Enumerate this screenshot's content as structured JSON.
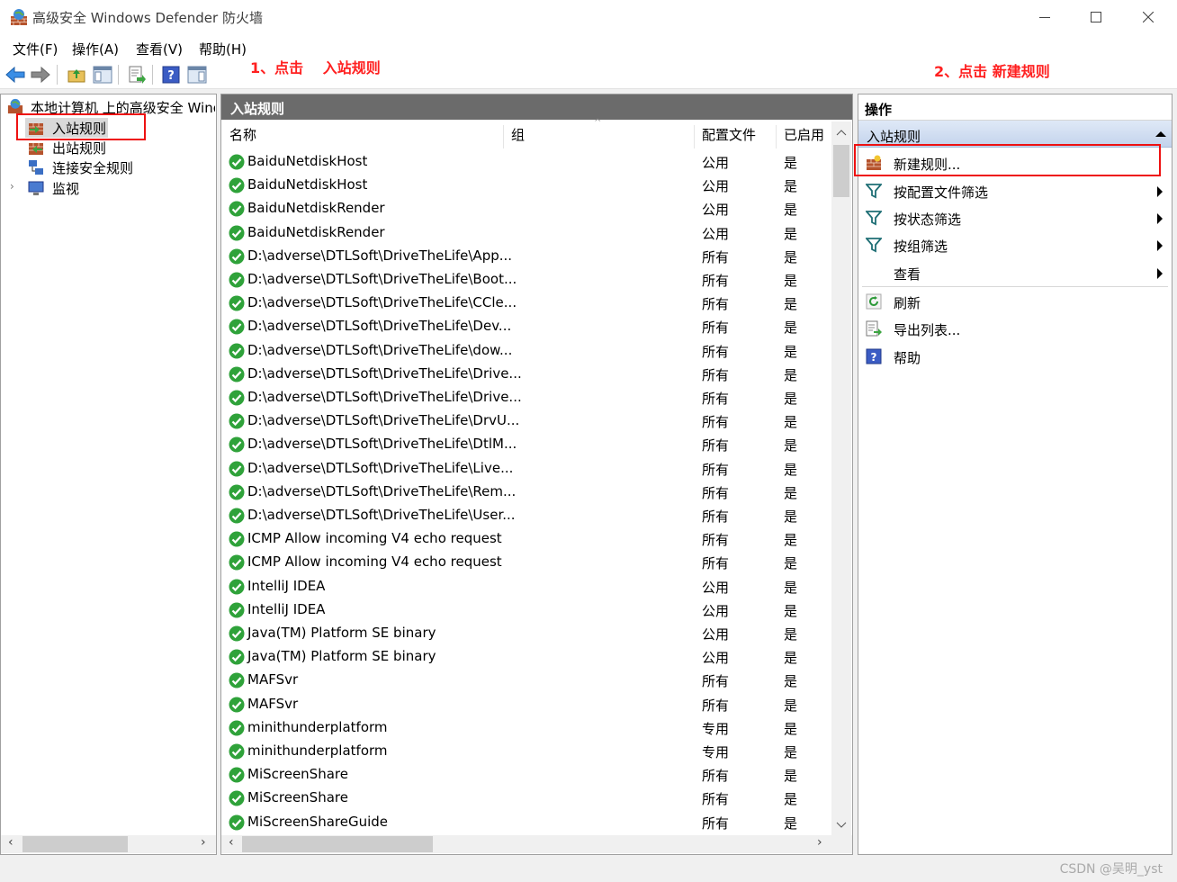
{
  "window": {
    "title": "高级安全 Windows Defender 防火墙",
    "icon": "firewall-globe-icon"
  },
  "menu": [
    "文件(F)",
    "操作(A)",
    "查看(V)",
    "帮助(H)"
  ],
  "annotations": {
    "step1": "1、点击　 入站规则",
    "step2": "2、点击  新建规则"
  },
  "tree": {
    "root": "本地计算机 上的高级安全 Windows Defender 防火墙",
    "items": [
      {
        "label": "入站规则",
        "icon": "inbound-rules-icon"
      },
      {
        "label": "出站规则",
        "icon": "outbound-rules-icon"
      },
      {
        "label": "连接安全规则",
        "icon": "connection-security-icon"
      },
      {
        "label": "监视",
        "icon": "monitor-icon"
      }
    ]
  },
  "center": {
    "title": "入站规则",
    "columns": {
      "name": "名称",
      "group": "组",
      "profile": "配置文件",
      "enabled": "已启用"
    },
    "rows": [
      {
        "name": "BaiduNetdiskHost",
        "profile": "公用",
        "enabled": "是"
      },
      {
        "name": "BaiduNetdiskHost",
        "profile": "公用",
        "enabled": "是"
      },
      {
        "name": "BaiduNetdiskRender",
        "profile": "公用",
        "enabled": "是"
      },
      {
        "name": "BaiduNetdiskRender",
        "profile": "公用",
        "enabled": "是"
      },
      {
        "name": "D:\\adverse\\DTLSoft\\DriveTheLife\\App...",
        "profile": "所有",
        "enabled": "是"
      },
      {
        "name": "D:\\adverse\\DTLSoft\\DriveTheLife\\Boot...",
        "profile": "所有",
        "enabled": "是"
      },
      {
        "name": "D:\\adverse\\DTLSoft\\DriveTheLife\\CCle...",
        "profile": "所有",
        "enabled": "是"
      },
      {
        "name": "D:\\adverse\\DTLSoft\\DriveTheLife\\Dev...",
        "profile": "所有",
        "enabled": "是"
      },
      {
        "name": "D:\\adverse\\DTLSoft\\DriveTheLife\\dow...",
        "profile": "所有",
        "enabled": "是"
      },
      {
        "name": "D:\\adverse\\DTLSoft\\DriveTheLife\\Drive...",
        "profile": "所有",
        "enabled": "是"
      },
      {
        "name": "D:\\adverse\\DTLSoft\\DriveTheLife\\Drive...",
        "profile": "所有",
        "enabled": "是"
      },
      {
        "name": "D:\\adverse\\DTLSoft\\DriveTheLife\\DrvU...",
        "profile": "所有",
        "enabled": "是"
      },
      {
        "name": "D:\\adverse\\DTLSoft\\DriveTheLife\\DtlM...",
        "profile": "所有",
        "enabled": "是"
      },
      {
        "name": "D:\\adverse\\DTLSoft\\DriveTheLife\\Live...",
        "profile": "所有",
        "enabled": "是"
      },
      {
        "name": "D:\\adverse\\DTLSoft\\DriveTheLife\\Rem...",
        "profile": "所有",
        "enabled": "是"
      },
      {
        "name": "D:\\adverse\\DTLSoft\\DriveTheLife\\User...",
        "profile": "所有",
        "enabled": "是"
      },
      {
        "name": "ICMP Allow incoming V4 echo request",
        "profile": "所有",
        "enabled": "是"
      },
      {
        "name": "ICMP Allow incoming V4 echo request",
        "profile": "所有",
        "enabled": "是"
      },
      {
        "name": "IntelliJ IDEA",
        "profile": "公用",
        "enabled": "是"
      },
      {
        "name": "IntelliJ IDEA",
        "profile": "公用",
        "enabled": "是"
      },
      {
        "name": "Java(TM) Platform SE binary",
        "profile": "公用",
        "enabled": "是"
      },
      {
        "name": "Java(TM) Platform SE binary",
        "profile": "公用",
        "enabled": "是"
      },
      {
        "name": "MAFSvr",
        "profile": "所有",
        "enabled": "是"
      },
      {
        "name": "MAFSvr",
        "profile": "所有",
        "enabled": "是"
      },
      {
        "name": "minithunderplatform",
        "profile": "专用",
        "enabled": "是"
      },
      {
        "name": "minithunderplatform",
        "profile": "专用",
        "enabled": "是"
      },
      {
        "name": "MiScreenShare",
        "profile": "所有",
        "enabled": "是"
      },
      {
        "name": "MiScreenShare",
        "profile": "所有",
        "enabled": "是"
      },
      {
        "name": "MiScreenShareGuide",
        "profile": "所有",
        "enabled": "是"
      }
    ]
  },
  "actions": {
    "title": "操作",
    "section": "入站规则",
    "items": [
      {
        "label": "新建规则...",
        "icon": "new-rule-icon",
        "submenu": false
      },
      {
        "label": "按配置文件筛选",
        "icon": "filter-icon",
        "submenu": true
      },
      {
        "label": "按状态筛选",
        "icon": "filter-icon",
        "submenu": true
      },
      {
        "label": "按组筛选",
        "icon": "filter-icon",
        "submenu": true
      },
      {
        "label": "查看",
        "icon": "",
        "submenu": true
      },
      {
        "label": "刷新",
        "icon": "refresh-icon",
        "submenu": false
      },
      {
        "label": "导出列表...",
        "icon": "export-list-icon",
        "submenu": false
      },
      {
        "label": "帮助",
        "icon": "help-icon",
        "submenu": false
      }
    ]
  },
  "watermark": "CSDN @吴明_yst",
  "colors": {
    "accent_red": "#e11111",
    "header_gray": "#6b6b6b",
    "check_green": "#2fa23a"
  }
}
